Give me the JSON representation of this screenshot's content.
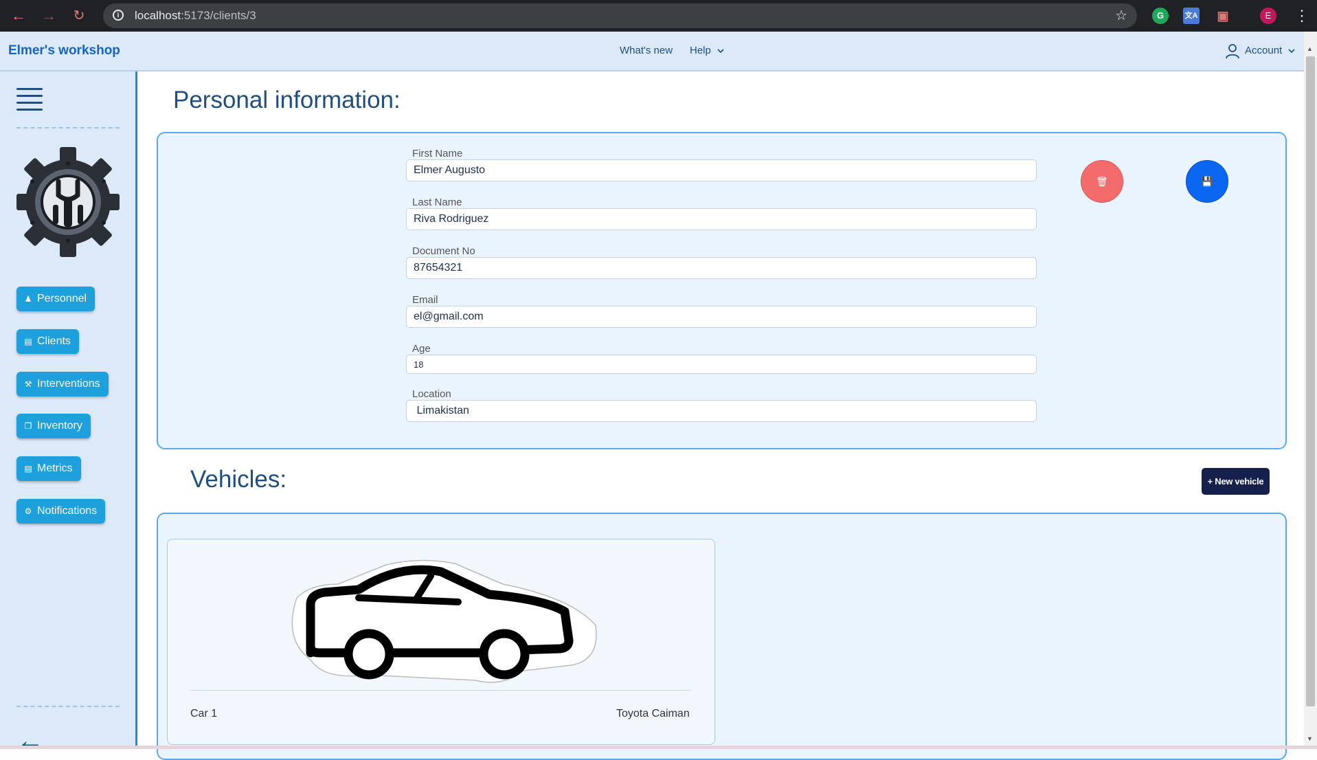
{
  "browser": {
    "url_host": "localhost",
    "url_path": ":5173/clients/3",
    "profile_initial": "E"
  },
  "header": {
    "brand": "Elmer's workshop",
    "whats_new": "What's new",
    "help": "Help",
    "account": "Account"
  },
  "sidebar": {
    "items": [
      {
        "label": "Personnel",
        "icon": "people-icon"
      },
      {
        "label": "Clients",
        "icon": "id-card-icon"
      },
      {
        "label": "Interventions",
        "icon": "wrench-icon"
      },
      {
        "label": "Inventory",
        "icon": "box-icon"
      },
      {
        "label": "Metrics",
        "icon": "bar-chart-icon"
      },
      {
        "label": "Notifications",
        "icon": "bell-icon"
      }
    ]
  },
  "personal": {
    "title": "Personal information:",
    "fields": [
      {
        "label": "First Name",
        "value": "Elmer Augusto"
      },
      {
        "label": "Last Name",
        "value": "Riva Rodriguez"
      },
      {
        "label": "Document No",
        "value": "87654321"
      },
      {
        "label": "Email",
        "value": "el@gmail.com"
      },
      {
        "label": "Age",
        "value": "18"
      },
      {
        "label": "Location",
        "value": " Limakistan"
      }
    ]
  },
  "vehicles": {
    "title": "Vehicles:",
    "new_button": "+ New vehicle",
    "cards": [
      {
        "name": "Car 1",
        "model": "Toyota Caiman"
      }
    ]
  },
  "colors": {
    "accent": "#1ea0dc",
    "delete": "#f46b6b",
    "save": "#0b66f2",
    "brand": "#1565c0"
  }
}
